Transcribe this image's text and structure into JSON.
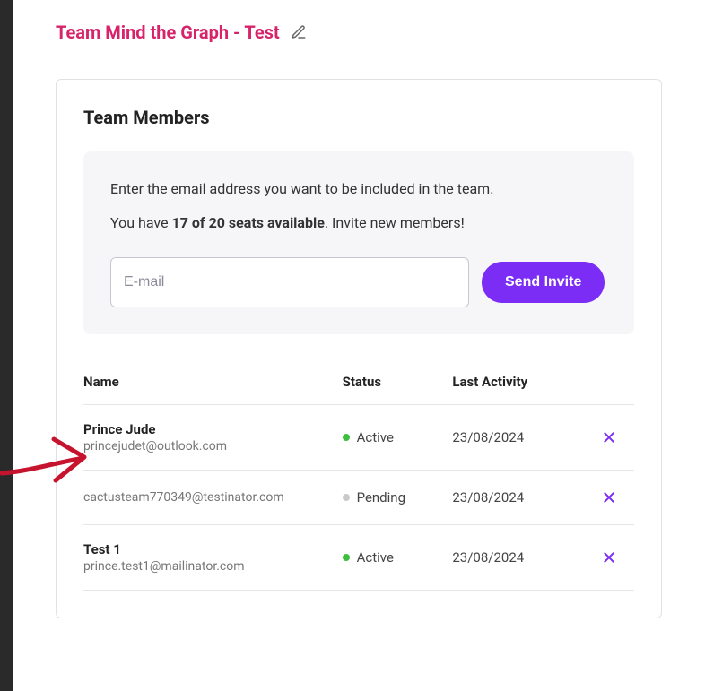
{
  "page": {
    "title": "Team Mind the Graph - Test"
  },
  "section": {
    "title": "Team Members"
  },
  "invite": {
    "intro": "Enter the email address you want to be included in the team.",
    "seats_pre": "You have ",
    "seats_bold": "17 of 20 seats available",
    "seats_post": ". Invite new members!",
    "placeholder": "E-mail",
    "button": "Send Invite"
  },
  "table": {
    "headers": {
      "name": "Name",
      "status": "Status",
      "activity": "Last Activity"
    },
    "rows": [
      {
        "name": "Prince Jude",
        "email": "princejudet@outlook.com",
        "status": "Active",
        "status_kind": "active",
        "activity": "23/08/2024"
      },
      {
        "name": "",
        "email": "cactusteam770349@testinator.com",
        "status": "Pending",
        "status_kind": "pending",
        "activity": "23/08/2024"
      },
      {
        "name": "Test 1",
        "email": "prince.test1@mailinator.com",
        "status": "Active",
        "status_kind": "active",
        "activity": "23/08/2024"
      }
    ]
  }
}
